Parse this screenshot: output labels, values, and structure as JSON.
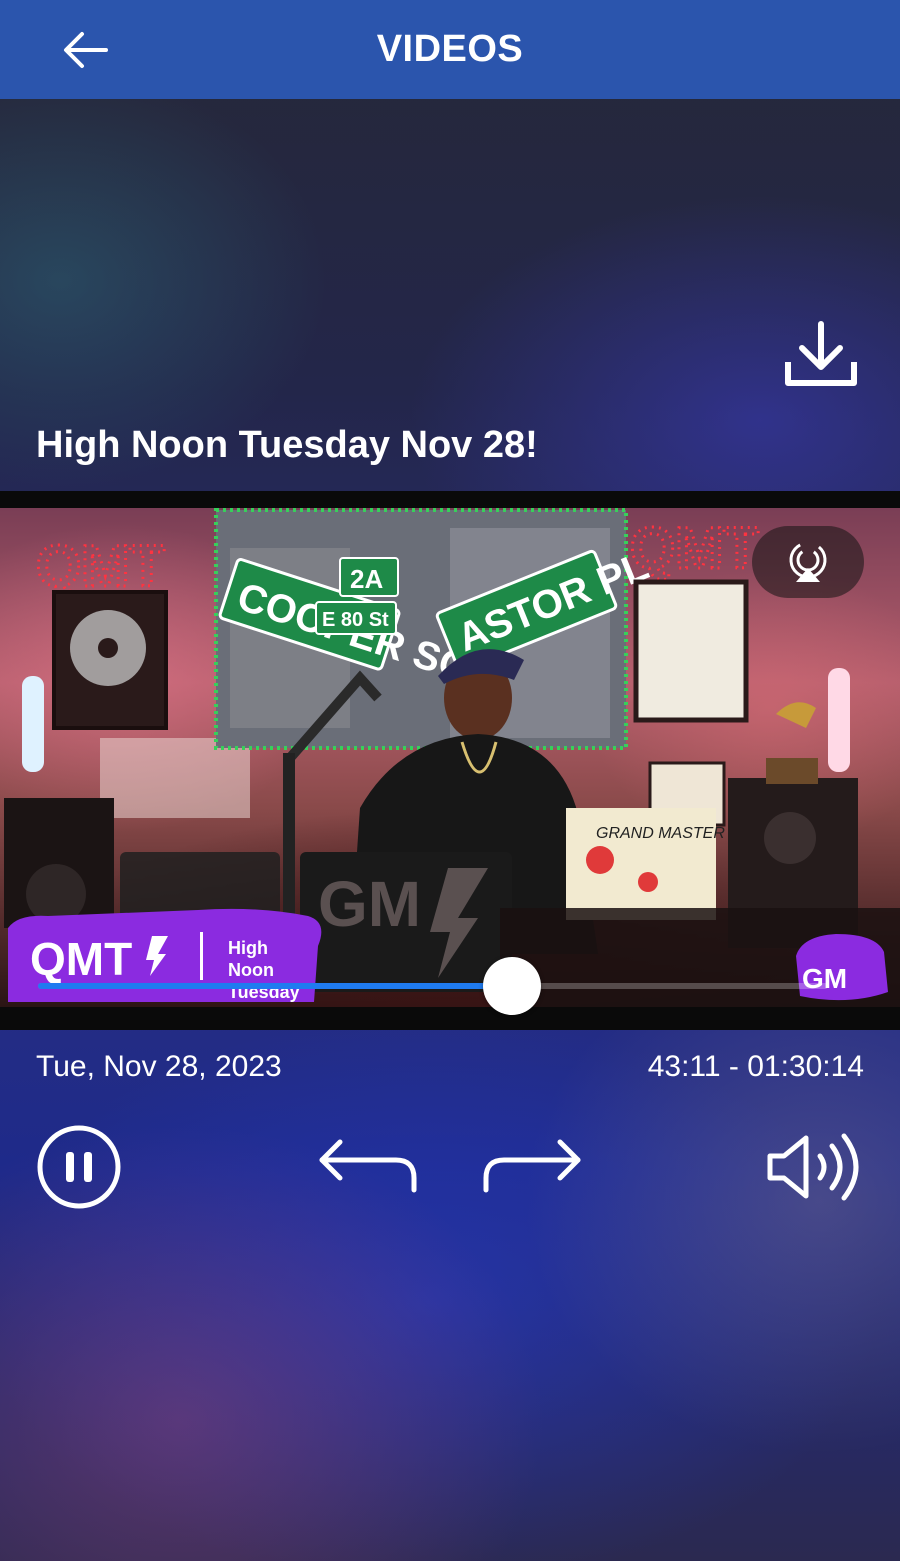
{
  "header": {
    "title": "VIDEOS",
    "back_icon": "arrow-left-icon"
  },
  "video": {
    "title": "High Noon Tuesday Nov 28!",
    "date": "Tue, Nov 28, 2023",
    "time": "43:11 - 01:30:14",
    "progress": 0.6,
    "overlay": {
      "left_logo": "QMT",
      "left_caption_lines": [
        "High",
        "Noon",
        "Tuesday"
      ],
      "right_logo": "GM",
      "center_logo": "GM",
      "sign_left": "COOPER SQ",
      "sign_top": "2A",
      "sign_mid": "E 80 St",
      "sign_right": "ASTOR PL",
      "neon_left": "QMT",
      "neon_right": "QMT",
      "poster_text": "GRAND MASTER"
    }
  },
  "controls": {
    "download_icon": "download-icon",
    "airplay_icon": "airplay-icon",
    "pause_icon": "pause-icon",
    "rewind_icon": "rewind-arrow-icon",
    "forward_icon": "forward-arrow-icon",
    "volume_icon": "volume-icon"
  },
  "colors": {
    "header": "#2b55ad",
    "progress": "#1f7bf0",
    "overlay_purple": "#8b2be0"
  }
}
